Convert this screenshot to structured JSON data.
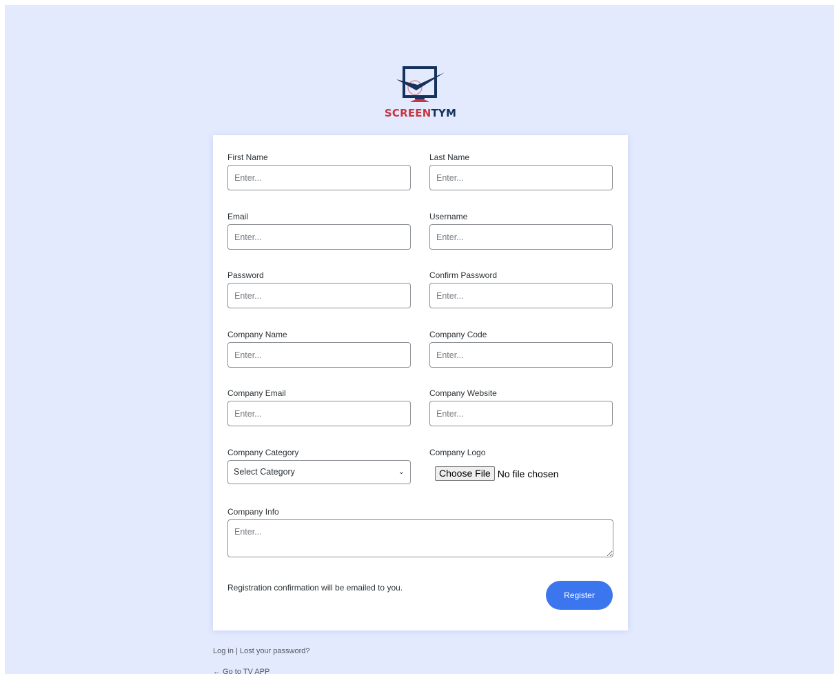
{
  "brand": {
    "name_part1": "SCREEN",
    "name_part2": "TYM",
    "colors": {
      "red": "#c8353f",
      "navy": "#16325c",
      "accent": "#3b76ef",
      "background": "#e3eafe"
    }
  },
  "form": {
    "first_name": {
      "label": "First Name",
      "placeholder": "Enter..."
    },
    "last_name": {
      "label": "Last Name",
      "placeholder": "Enter..."
    },
    "email": {
      "label": "Email",
      "placeholder": "Enter..."
    },
    "username": {
      "label": "Username",
      "placeholder": "Enter..."
    },
    "password": {
      "label": "Password",
      "placeholder": "Enter..."
    },
    "confirm_password": {
      "label": "Confirm Password",
      "placeholder": "Enter..."
    },
    "company_name": {
      "label": "Company Name",
      "placeholder": "Enter..."
    },
    "company_code": {
      "label": "Company Code",
      "placeholder": "Enter..."
    },
    "company_email": {
      "label": "Company Email",
      "placeholder": "Enter..."
    },
    "company_website": {
      "label": "Company Website",
      "placeholder": "Enter..."
    },
    "company_category": {
      "label": "Company Category",
      "selected": "Select Category"
    },
    "company_logo": {
      "label": "Company Logo",
      "button": "Choose File",
      "status": "No file chosen"
    },
    "company_info": {
      "label": "Company Info",
      "placeholder": "Enter..."
    },
    "notice": "Registration confirmation will be emailed to you.",
    "register_label": "Register"
  },
  "footer": {
    "login": "Log in",
    "separator": "|",
    "lost_password": "Lost your password?",
    "back": "← Go to TV APP"
  }
}
